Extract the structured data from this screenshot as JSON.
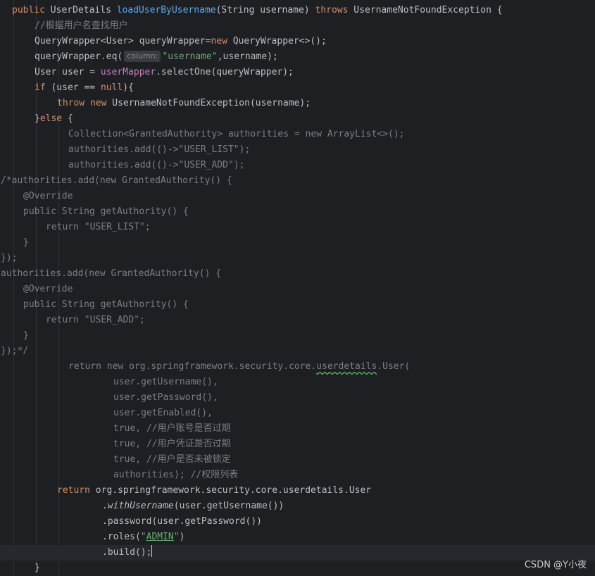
{
  "watermark": "CSDN @Y小夜",
  "tokens": {
    "l1": [
      "public",
      "UserDetails",
      "loadUserByUsername",
      "(String username)",
      "throws",
      "UsernameNotFoundException {"
    ],
    "l2": [
      "//根据用户名查找用户"
    ],
    "l3": [
      "QueryWrapper<User> queryWrapper=",
      "new",
      "QueryWrapper<>();"
    ],
    "l4": [
      "queryWrapper.eq(",
      "column:",
      "\"username\"",
      ",username);"
    ],
    "l5": [
      "User user = ",
      "userMapper",
      ".selectOne(queryWrapper);"
    ],
    "l6": [
      "if",
      " (user == ",
      "null",
      "){"
    ],
    "l7": [
      "throw",
      "new",
      "UsernameNotFoundException(username);"
    ],
    "l8": [
      "}",
      "else",
      " {"
    ],
    "l9": [
      "Collection<GrantedAuthority> authorities = new ArrayList<>();"
    ],
    "l10": [
      "authorities.add(()->\"USER_LIST\");"
    ],
    "l11": [
      "authorities.add(()->\"USER_ADD\");"
    ],
    "l12": [
      "/*authorities.add(new GrantedAuthority() {"
    ],
    "l13": [
      "@Override"
    ],
    "l14": [
      "public String getAuthority() {"
    ],
    "l15": [
      "return \"USER_LIST\";"
    ],
    "l16": [
      "}"
    ],
    "l17": [
      "});"
    ],
    "l18": [
      "authorities.add(new GrantedAuthority() {"
    ],
    "l19": [
      "@Override"
    ],
    "l20": [
      "public String getAuthority() {"
    ],
    "l21": [
      "return \"USER_ADD\";"
    ],
    "l22": [
      "}"
    ],
    "l23": [
      "});*/"
    ],
    "l24": [
      "return new org.springframework.security.core.",
      "userdetails",
      ".User("
    ],
    "l25": [
      "user.getUsername(),"
    ],
    "l26": [
      "user.getPassword(),"
    ],
    "l27": [
      "user.getEnabled(),"
    ],
    "l28": [
      "true, //用户账号是否过期"
    ],
    "l29": [
      "true, //用户凭证是否过期"
    ],
    "l30": [
      "true, //用户是否未被锁定"
    ],
    "l31": [
      "authorities); //权限列表"
    ],
    "l32": [
      "return",
      "org.springframework.security.core.userdetails.User"
    ],
    "l33": [
      ".",
      "withUsername",
      "(user.getUsername())"
    ],
    "l34": [
      ".password(user.getPassword())"
    ],
    "l35": [
      ".roles(",
      "\"",
      "ADMIN",
      "\"",
      ")"
    ],
    "l36": [
      ".build();"
    ],
    "l37": [
      "}"
    ]
  }
}
